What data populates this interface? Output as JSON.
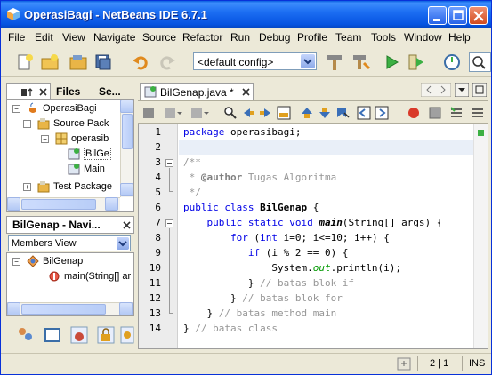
{
  "window": {
    "title": "OperasiBagi - NetBeans IDE 6.7.1"
  },
  "menu": [
    "File",
    "Edit",
    "View",
    "Navigate",
    "Source",
    "Refactor",
    "Run",
    "Debug",
    "Profile",
    "Team",
    "Tools",
    "Window",
    "Help"
  ],
  "toolbar": {
    "config_value": "<default config>"
  },
  "projects_panel": {
    "tabs": [
      "Files",
      "Se..."
    ],
    "tree": [
      {
        "label": "OperasiBagi"
      },
      {
        "label": "Source Pack"
      },
      {
        "label": "operasib"
      },
      {
        "label": "BilGe"
      },
      {
        "label": "Main"
      },
      {
        "label": "Test Package"
      }
    ]
  },
  "navigator_panel": {
    "title": "BilGenap - Navi...",
    "filter_value": "Members View",
    "tree": [
      {
        "label": "BilGenap"
      },
      {
        "label": "main(String[] ar"
      }
    ]
  },
  "editor": {
    "tab_label": "BilGenap.java *",
    "line_numbers": [
      "1",
      "2",
      "3",
      "4",
      "5",
      "6",
      "7",
      "8",
      "9",
      "10",
      "11",
      "12",
      "13",
      "14"
    ],
    "lines": {
      "l1_kw": "package",
      "l1_rest": " operasibagi;",
      "l3": "/**",
      "l4_a": " * ",
      "l4_ann": "@author",
      "l4_b": " Tugas Algoritma",
      "l5": " */",
      "l6_kw": "public class",
      "l6_sp": " ",
      "l6_cls": "BilGenap",
      "l6_rest": " {",
      "l7_pre": "    ",
      "l7_kw": "public static void",
      "l7_sp": " ",
      "l7_m": "main",
      "l7_rest": "(String[] args) {",
      "l8_pre": "        ",
      "l8_kw": "for",
      "l8_a": " (",
      "l8_kw2": "int",
      "l8_rest": " i=0; i<=10; i++) {",
      "l9_pre": "           ",
      "l9_kw": "if",
      "l9_rest": " (i % 2 == 0) {",
      "l10_pre": "               System.",
      "l10_f": "out",
      "l10_rest": ".println(i);",
      "l11_pre": "           } ",
      "l11_cm": "// batas blok if",
      "l12_pre": "        } ",
      "l12_cm": "// batas blok for",
      "l13_pre": "    } ",
      "l13_cm": "// batas method main",
      "l14_pre": "} ",
      "l14_cm": "// batas class"
    }
  },
  "status": {
    "position": "2 | 1",
    "mode": "INS"
  }
}
